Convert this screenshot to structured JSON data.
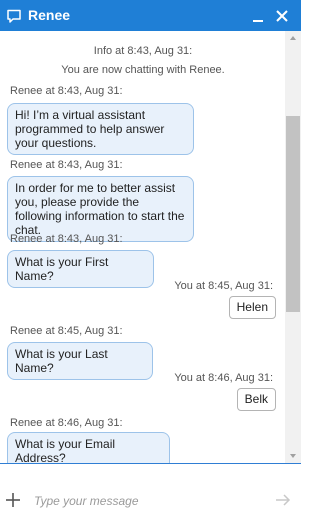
{
  "header": {
    "title": "Renee",
    "background": "#1f7fd6",
    "icons": [
      "chat-bubble-icon",
      "minimize-icon",
      "close-icon"
    ]
  },
  "messages": {
    "info_meta": "Info at 8:43, Aug 31:",
    "info_text": "You are now chatting with Renee.",
    "items": [
      {
        "meta": "Renee at 8:43, Aug 31:",
        "text": "Hi! I’m a virtual assistant programmed to help answer your questions."
      },
      {
        "meta": "Renee at 8:43, Aug 31:",
        "text": "In order for me to better assist you, please provide the following information to start the chat."
      },
      {
        "meta": "Renee at 8:43, Aug 31:",
        "text": "What is your First Name?"
      },
      {
        "meta": "You at 8:45, Aug 31:",
        "text": "Helen"
      },
      {
        "meta": "Renee at 8:45, Aug 31:",
        "text": "What is your Last Name?"
      },
      {
        "meta": "You at 8:46, Aug 31:",
        "text": "Belk"
      },
      {
        "meta": "Renee at 8:46, Aug 31:",
        "text": "What is your Email Address?"
      }
    ]
  },
  "composer": {
    "placeholder": "Type your message",
    "value": "",
    "icons": [
      "plus-icon",
      "send-arrow-icon"
    ],
    "divider_color": "#2f7ed4"
  }
}
